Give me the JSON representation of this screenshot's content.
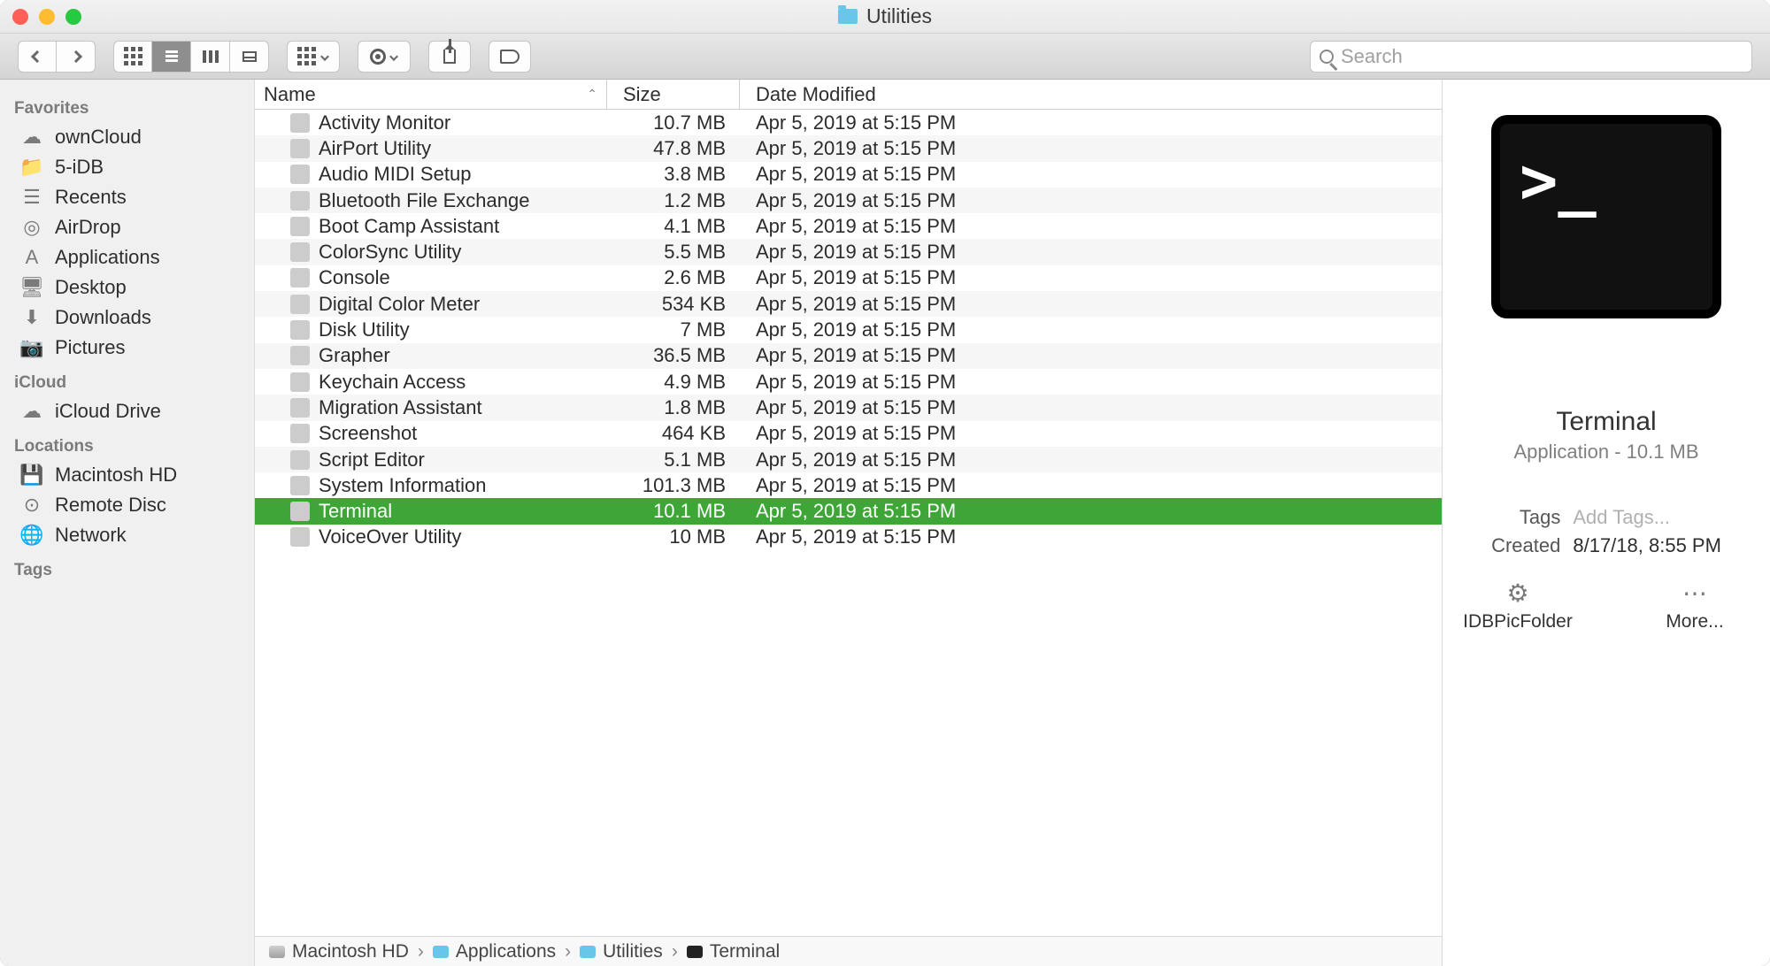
{
  "window": {
    "title": "Utilities"
  },
  "search": {
    "placeholder": "Search"
  },
  "sidebar": {
    "sections": [
      {
        "header": "Favorites",
        "items": [
          {
            "icon": "☁",
            "label": "ownCloud"
          },
          {
            "icon": "📁",
            "label": "5-iDB"
          },
          {
            "icon": "☰",
            "label": "Recents"
          },
          {
            "icon": "◎",
            "label": "AirDrop"
          },
          {
            "icon": "A",
            "label": "Applications"
          },
          {
            "icon": "🖥",
            "label": "Desktop"
          },
          {
            "icon": "⬇",
            "label": "Downloads"
          },
          {
            "icon": "📷",
            "label": "Pictures"
          }
        ]
      },
      {
        "header": "iCloud",
        "items": [
          {
            "icon": "☁",
            "label": "iCloud Drive"
          }
        ]
      },
      {
        "header": "Locations",
        "items": [
          {
            "icon": "💾",
            "label": "Macintosh HD"
          },
          {
            "icon": "⊙",
            "label": "Remote Disc"
          },
          {
            "icon": "🌐",
            "label": "Network"
          }
        ]
      },
      {
        "header": "Tags",
        "items": []
      }
    ]
  },
  "columns": {
    "name": "Name",
    "size": "Size",
    "date": "Date Modified"
  },
  "files": [
    {
      "name": "Activity Monitor",
      "size": "10.7 MB",
      "date": "Apr 5, 2019 at 5:15 PM",
      "sel": false
    },
    {
      "name": "AirPort Utility",
      "size": "47.8 MB",
      "date": "Apr 5, 2019 at 5:15 PM",
      "sel": false
    },
    {
      "name": "Audio MIDI Setup",
      "size": "3.8 MB",
      "date": "Apr 5, 2019 at 5:15 PM",
      "sel": false
    },
    {
      "name": "Bluetooth File Exchange",
      "size": "1.2 MB",
      "date": "Apr 5, 2019 at 5:15 PM",
      "sel": false
    },
    {
      "name": "Boot Camp Assistant",
      "size": "4.1 MB",
      "date": "Apr 5, 2019 at 5:15 PM",
      "sel": false
    },
    {
      "name": "ColorSync Utility",
      "size": "5.5 MB",
      "date": "Apr 5, 2019 at 5:15 PM",
      "sel": false
    },
    {
      "name": "Console",
      "size": "2.6 MB",
      "date": "Apr 5, 2019 at 5:15 PM",
      "sel": false
    },
    {
      "name": "Digital Color Meter",
      "size": "534 KB",
      "date": "Apr 5, 2019 at 5:15 PM",
      "sel": false
    },
    {
      "name": "Disk Utility",
      "size": "7 MB",
      "date": "Apr 5, 2019 at 5:15 PM",
      "sel": false
    },
    {
      "name": "Grapher",
      "size": "36.5 MB",
      "date": "Apr 5, 2019 at 5:15 PM",
      "sel": false
    },
    {
      "name": "Keychain Access",
      "size": "4.9 MB",
      "date": "Apr 5, 2019 at 5:15 PM",
      "sel": false
    },
    {
      "name": "Migration Assistant",
      "size": "1.8 MB",
      "date": "Apr 5, 2019 at 5:15 PM",
      "sel": false
    },
    {
      "name": "Screenshot",
      "size": "464 KB",
      "date": "Apr 5, 2019 at 5:15 PM",
      "sel": false
    },
    {
      "name": "Script Editor",
      "size": "5.1 MB",
      "date": "Apr 5, 2019 at 5:15 PM",
      "sel": false
    },
    {
      "name": "System Information",
      "size": "101.3 MB",
      "date": "Apr 5, 2019 at 5:15 PM",
      "sel": false
    },
    {
      "name": "Terminal",
      "size": "10.1 MB",
      "date": "Apr 5, 2019 at 5:15 PM",
      "sel": true
    },
    {
      "name": "VoiceOver Utility",
      "size": "10 MB",
      "date": "Apr 5, 2019 at 5:15 PM",
      "sel": false
    }
  ],
  "preview": {
    "title": "Terminal",
    "subtitle": "Application - 10.1 MB",
    "tags_label": "Tags",
    "tags_placeholder": "Add Tags...",
    "created_label": "Created",
    "created_value": "8/17/18, 8:55 PM",
    "action1": "IDBPicFolder",
    "action2": "More..."
  },
  "path": [
    {
      "icon": "hd",
      "label": "Macintosh HD"
    },
    {
      "icon": "fl",
      "label": "Applications"
    },
    {
      "icon": "fl",
      "label": "Utilities"
    },
    {
      "icon": "tm",
      "label": "Terminal"
    }
  ]
}
